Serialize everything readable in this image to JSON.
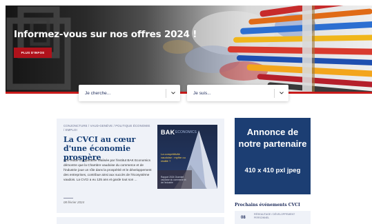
{
  "hero": {
    "title": "Informez-vous sur nos offres 2024 !",
    "button_label": "PLUS D'INFOS"
  },
  "search": {
    "select1_placeholder": "Je cherche...",
    "select2_placeholder": "Je suis..."
  },
  "article": {
    "tags": "CONJONCTURE / VAUD-GENÈVE / POLITIQUE ÉCONOMIE / EMPLOI",
    "title": "La CVCI au cœur d'une économie prospère",
    "body": "Une étude comparative réalisée par l'institut BAK Economics démontre que la Chambre vaudoise du commerce et de l'industrie joue un rôle dans la prospérité et le développement des entreprises, contribue ainsi aux succès de l'écosystème vaudois. La CVCI a eu 125 ans et garde tout son ...",
    "date": "08 février 2024",
    "thumbnail": {
      "logo": "BAK",
      "logo_suffix": "ECONOMICS",
      "caption": "La compétitivité vaudoise : mythe ou réalité ?",
      "footer": "Rapport 2024 Chambre vaudoise du commerce et de l'industrie"
    }
  },
  "ad": {
    "line1": "Annonce de notre partenaire",
    "line2": "410 x 410 pxl jpeg"
  },
  "events": {
    "title": "Prochains événements CVCI",
    "first": {
      "day": "08",
      "tags": "RÉSEAUTAGE / DÉVELOPPEMENT PERSONNEL"
    }
  },
  "colors": {
    "brand_red": "#b0121b",
    "navy": "#1c3e73",
    "title_blue": "#123b73",
    "card_bg": "#eff2f8"
  }
}
